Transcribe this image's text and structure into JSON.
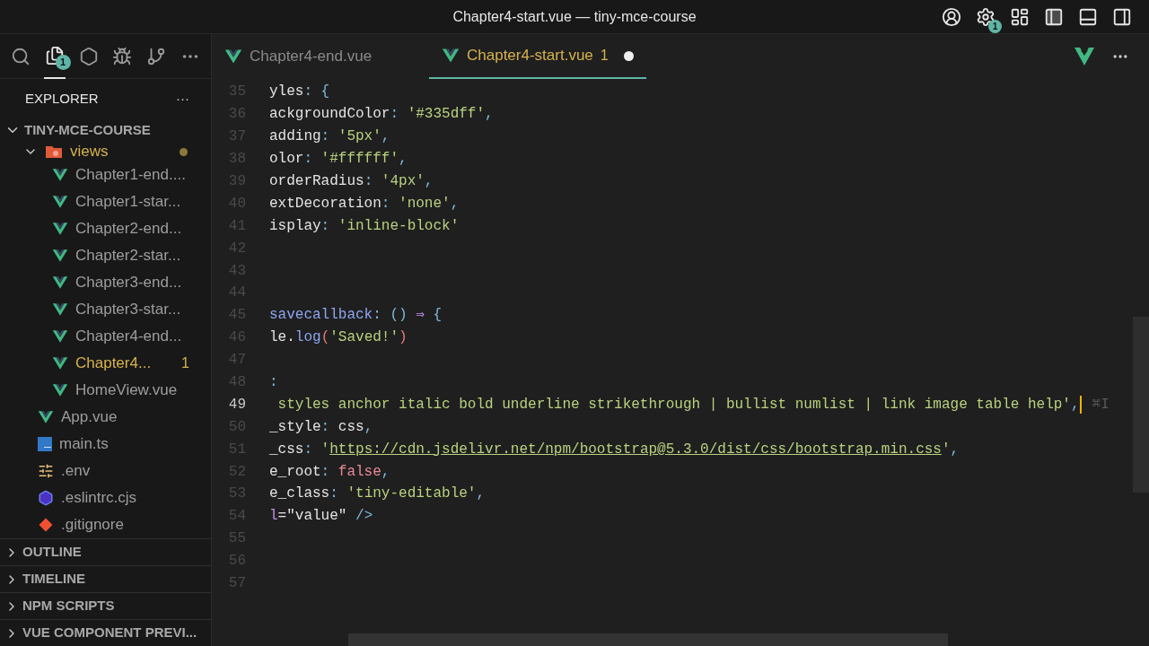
{
  "window": {
    "title": "Chapter4-start.vue — tiny-mce-course"
  },
  "title_actions": [
    {
      "kind": "account"
    },
    {
      "kind": "settings",
      "badge": "1"
    },
    {
      "kind": "layout"
    },
    {
      "kind": "sidebar",
      "selected": true
    },
    {
      "kind": "panel",
      "selected": false
    },
    {
      "kind": "secondary",
      "selected": false
    }
  ],
  "activity_bar": [
    {
      "kind": "search",
      "selected": false
    },
    {
      "kind": "explorer",
      "selected": true,
      "badge": "1"
    },
    {
      "kind": "extension",
      "selected": false
    },
    {
      "kind": "debug",
      "selected": false
    },
    {
      "kind": "source-control",
      "selected": false
    },
    {
      "kind": "more",
      "selected": false
    }
  ],
  "explorer": {
    "title": "EXPLORER",
    "more": "···",
    "root": {
      "label": "TINY-MCE-COURSE",
      "expanded": true,
      "children": [
        {
          "label": "views",
          "kind": "folder",
          "expanded": true,
          "modified": true,
          "children": [
            {
              "label": "Chapter1-end....",
              "kind": "vue",
              "modified": false
            },
            {
              "label": "Chapter1-star...",
              "kind": "vue",
              "modified": false
            },
            {
              "label": "Chapter2-end...",
              "kind": "vue",
              "modified": false
            },
            {
              "label": "Chapter2-star...",
              "kind": "vue",
              "modified": false
            },
            {
              "label": "Chapter3-end...",
              "kind": "vue",
              "modified": false
            },
            {
              "label": "Chapter3-star...",
              "kind": "vue",
              "modified": false
            },
            {
              "label": "Chapter4-end...",
              "kind": "vue",
              "modified": false
            },
            {
              "label": "Chapter4...",
              "kind": "vue",
              "modified": true,
              "badge": "1"
            },
            {
              "label": "HomeView.vue",
              "kind": "vue",
              "modified": false
            }
          ]
        },
        {
          "label": "App.vue",
          "kind": "vue",
          "modified": false
        },
        {
          "label": "main.ts",
          "kind": "ts",
          "modified": false
        },
        {
          "label": ".env",
          "kind": "env",
          "modified": false
        },
        {
          "label": ".eslintrc.cjs",
          "kind": "eslint",
          "modified": false
        },
        {
          "label": ".gitignore",
          "kind": "git",
          "modified": false
        }
      ]
    }
  },
  "panels": [
    {
      "label": "OUTLINE",
      "expanded": false
    },
    {
      "label": "TIMELINE",
      "expanded": false
    },
    {
      "label": "NPM SCRIPTS",
      "expanded": false
    },
    {
      "label": "VUE COMPONENT PREVI...",
      "expanded": false
    }
  ],
  "tabs": [
    {
      "label": "Chapter4-end.vue",
      "selected": false,
      "modified": false
    },
    {
      "label": "Chapter4-start.vue",
      "selected": true,
      "modified": true,
      "badge": "1"
    }
  ],
  "editor": {
    "lines": [
      {
        "number": "35",
        "tokens": [
          {
            "text": "yles",
            "kind": "key"
          },
          {
            "text": ": {",
            "kind": "punct"
          }
        ]
      },
      {
        "number": "36",
        "tokens": [
          {
            "text": "ackgroundColor",
            "kind": "key"
          },
          {
            "text": ": ",
            "kind": "punct"
          },
          {
            "text": "'#335dff'",
            "kind": "string"
          },
          {
            "text": ",",
            "kind": "punct"
          }
        ]
      },
      {
        "number": "37",
        "tokens": [
          {
            "text": "adding",
            "kind": "key"
          },
          {
            "text": ": ",
            "kind": "punct"
          },
          {
            "text": "'5px'",
            "kind": "string"
          },
          {
            "text": ",",
            "kind": "punct"
          }
        ]
      },
      {
        "number": "38",
        "tokens": [
          {
            "text": "olor",
            "kind": "key"
          },
          {
            "text": ": ",
            "kind": "punct"
          },
          {
            "text": "'#ffffff'",
            "kind": "string"
          },
          {
            "text": ",",
            "kind": "punct"
          }
        ]
      },
      {
        "number": "39",
        "tokens": [
          {
            "text": "orderRadius",
            "kind": "key"
          },
          {
            "text": ": ",
            "kind": "punct"
          },
          {
            "text": "'4px'",
            "kind": "string"
          },
          {
            "text": ",",
            "kind": "punct"
          }
        ]
      },
      {
        "number": "40",
        "tokens": [
          {
            "text": "extDecoration",
            "kind": "key"
          },
          {
            "text": ": ",
            "kind": "punct"
          },
          {
            "text": "'none'",
            "kind": "string"
          },
          {
            "text": ",",
            "kind": "punct"
          }
        ]
      },
      {
        "number": "41",
        "tokens": [
          {
            "text": "isplay",
            "kind": "key"
          },
          {
            "text": ": ",
            "kind": "punct"
          },
          {
            "text": "'inline-block'",
            "kind": "string"
          }
        ]
      },
      {
        "number": "42"
      },
      {
        "number": "43"
      },
      {
        "number": "44"
      },
      {
        "number": "45",
        "tokens": [
          {
            "text": "savecallback",
            "kind": "func"
          },
          {
            "text": ": () ",
            "kind": "punct"
          },
          {
            "text": "⇒",
            "kind": "operator"
          },
          {
            "text": " {",
            "kind": "punct"
          }
        ]
      },
      {
        "number": "46",
        "tokens": [
          {
            "text": "le.",
            "kind": "key"
          },
          {
            "text": "log",
            "kind": "func"
          },
          {
            "text": "(",
            "kind": "paren"
          },
          {
            "text": "'Saved!'",
            "kind": "string"
          },
          {
            "text": ")",
            "kind": "paren"
          }
        ]
      },
      {
        "number": "47"
      },
      {
        "number": "48",
        "tokens": [
          {
            "text": ":",
            "kind": "punct"
          }
        ]
      },
      {
        "number": "49",
        "current": true,
        "tokens": [
          {
            "text": " styles anchor italic bold underline strikethrough | bullist numlist | link image table help'",
            "kind": "string"
          },
          {
            "text": ",",
            "kind": "punct"
          },
          {
            "text": "⌘I",
            "kind": "hint"
          }
        ]
      },
      {
        "number": "50",
        "tokens": [
          {
            "text": "_style",
            "kind": "key"
          },
          {
            "text": ": ",
            "kind": "punct"
          },
          {
            "text": "css",
            "kind": "key"
          },
          {
            "text": ",",
            "kind": "punct"
          }
        ]
      },
      {
        "number": "51",
        "tokens": [
          {
            "text": "_css",
            "kind": "key"
          },
          {
            "text": ": ",
            "kind": "punct"
          },
          {
            "text": "'",
            "kind": "string"
          },
          {
            "text": "https://cdn.jsdelivr.net/npm/bootstrap@5.3.0/dist/css/bootstrap.min.css",
            "kind": "url"
          },
          {
            "text": "'",
            "kind": "string"
          },
          {
            "text": ",",
            "kind": "punct"
          }
        ]
      },
      {
        "number": "52",
        "tokens": [
          {
            "text": "e_root",
            "kind": "key"
          },
          {
            "text": ": ",
            "kind": "punct"
          },
          {
            "text": "false",
            "kind": "literal"
          },
          {
            "text": ",",
            "kind": "punct"
          }
        ]
      },
      {
        "number": "53",
        "tokens": [
          {
            "text": "e_class",
            "kind": "key"
          },
          {
            "text": ": ",
            "kind": "punct"
          },
          {
            "text": "'tiny-editable'",
            "kind": "string"
          },
          {
            "text": ",",
            "kind": "punct"
          }
        ]
      },
      {
        "number": "54",
        "tokens": [
          {
            "text": "l",
            "kind": "attr"
          },
          {
            "text": "=\"value\" ",
            "kind": "key"
          },
          {
            "text": "/>",
            "kind": "punct"
          }
        ]
      },
      {
        "number": "55"
      },
      {
        "number": "56"
      },
      {
        "number": "57"
      }
    ]
  }
}
